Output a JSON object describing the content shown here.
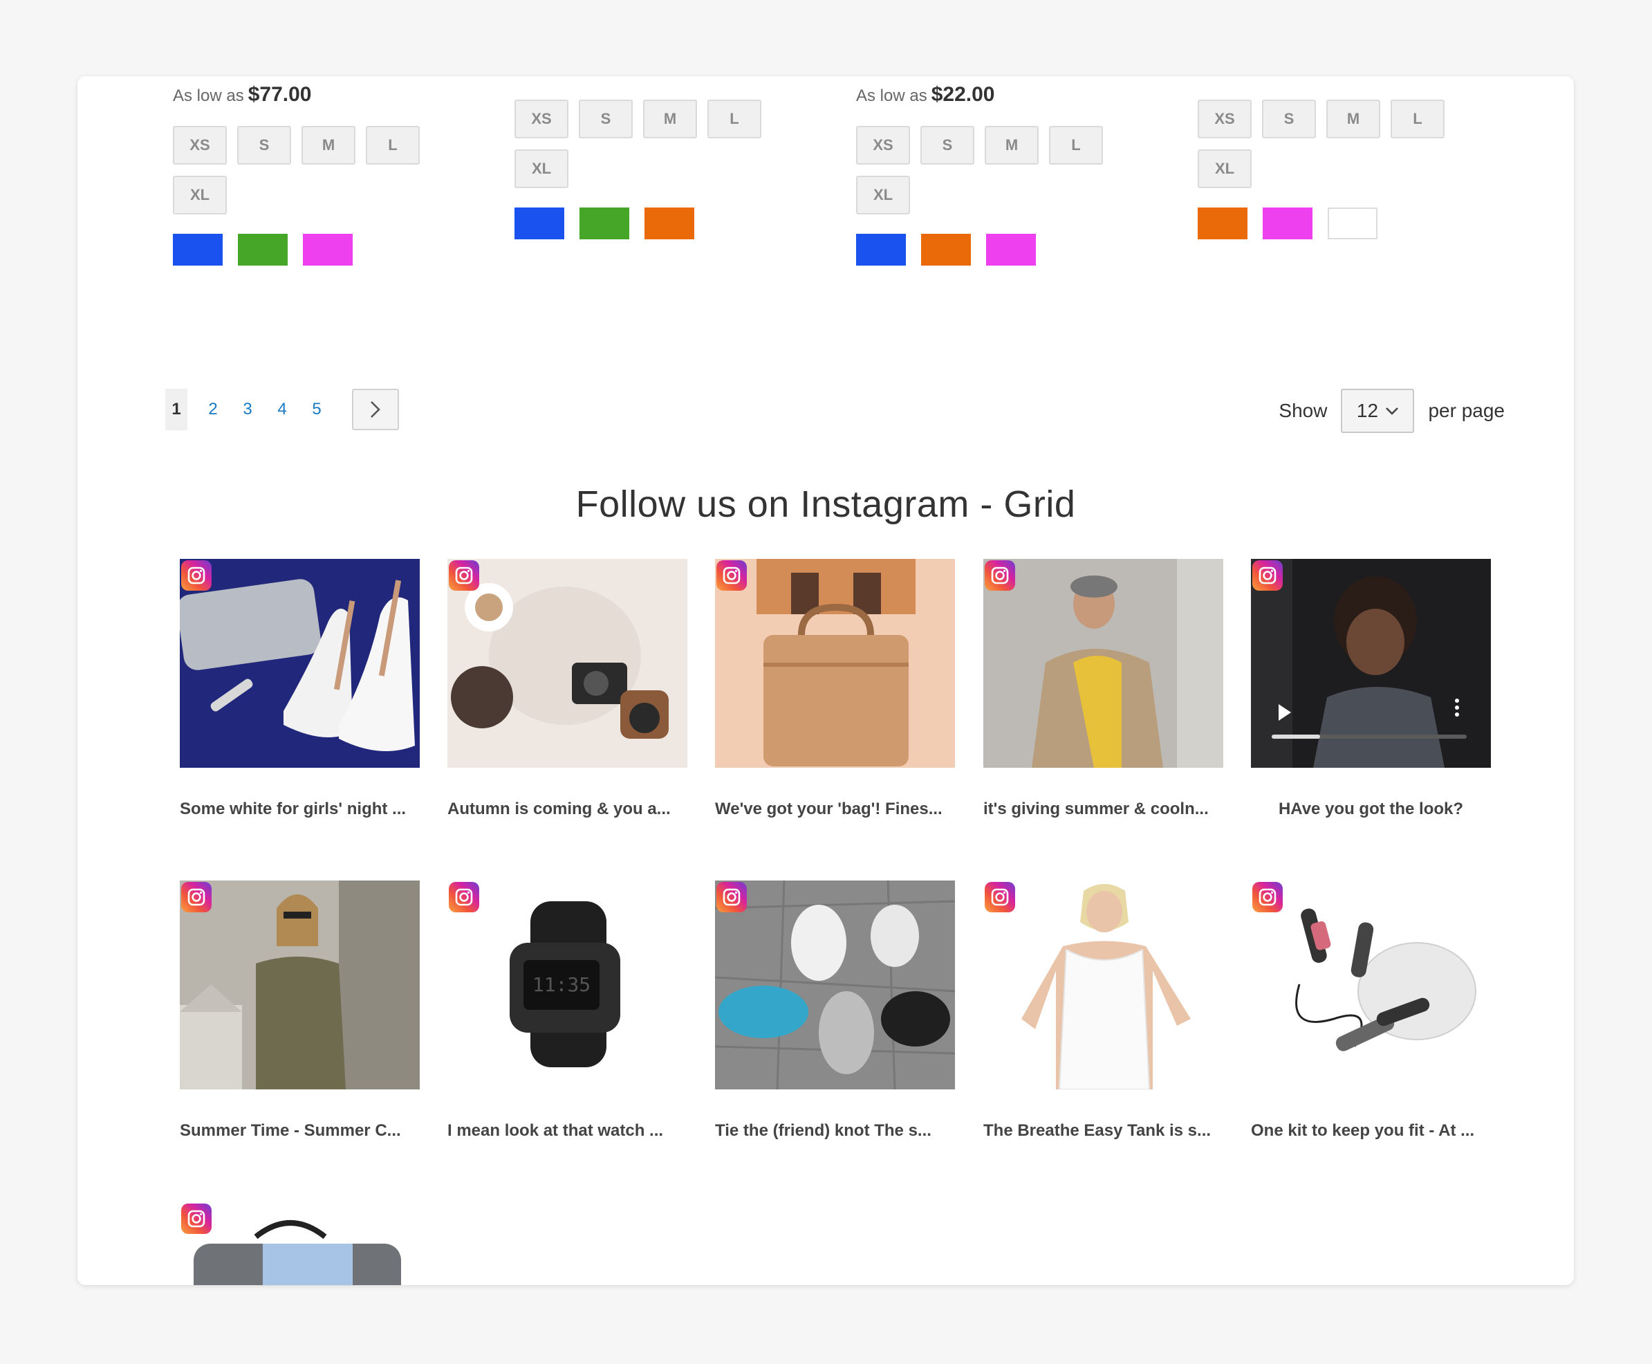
{
  "products": [
    {
      "price_prefix": "As low as",
      "price": "$77.00",
      "sizes": [
        "XS",
        "S",
        "M",
        "L",
        "XL"
      ],
      "swatches": [
        "#1a52f0",
        "#46a628",
        "#ef40ef"
      ]
    },
    {
      "price_prefix": "",
      "price": "",
      "sizes": [
        "XS",
        "S",
        "M",
        "L",
        "XL"
      ],
      "swatches": [
        "#1a52f0",
        "#46a628",
        "#ea6a0a"
      ]
    },
    {
      "price_prefix": "As low as",
      "price": "$22.00",
      "sizes": [
        "XS",
        "S",
        "M",
        "L",
        "XL"
      ],
      "swatches": [
        "#1a52f0",
        "#ea6a0a",
        "#ef40ef"
      ]
    },
    {
      "price_prefix": "",
      "price": "",
      "sizes": [
        "XS",
        "S",
        "M",
        "L",
        "XL"
      ],
      "swatches": [
        "#ea6a0a",
        "#ef40ef",
        "#ffffff"
      ]
    }
  ],
  "pagination": {
    "pages": [
      "1",
      "2",
      "3",
      "4",
      "5"
    ],
    "current": "1",
    "next_icon": "chevron-right-icon"
  },
  "limiter": {
    "show_label": "Show",
    "value": "12",
    "suffix": "per page"
  },
  "instagram": {
    "title": "Follow us on Instagram - Grid",
    "badge_icon": "instagram-icon",
    "posts": [
      {
        "caption": "Some white for girls' night ...",
        "image": "white-heels-and-clutch"
      },
      {
        "caption": "Autumn is coming & you a...",
        "image": "sweater-coffee-camera"
      },
      {
        "caption": "We've got your 'bag'! Fines...",
        "image": "tan-leather-bag"
      },
      {
        "caption": "it's giving summer & cooln...",
        "image": "man-in-yellow-shirt"
      },
      {
        "caption": "HAve you got the look?",
        "image": "video-woman"
      },
      {
        "caption": "Summer Time - Summer C...",
        "image": "woman-in-olive-dress"
      },
      {
        "caption": "I mean look at that watch ...",
        "image": "black-digital-watch"
      },
      {
        "caption": "Tie the (friend) knot The s...",
        "image": "sneakers-circle"
      },
      {
        "caption": "The Breathe Easy Tank is s...",
        "image": "white-tank-top"
      },
      {
        "caption": "One kit to keep you fit - At ...",
        "image": "jump-rope-kit"
      },
      {
        "caption": "",
        "image": "grey-duffel-bag"
      }
    ]
  }
}
